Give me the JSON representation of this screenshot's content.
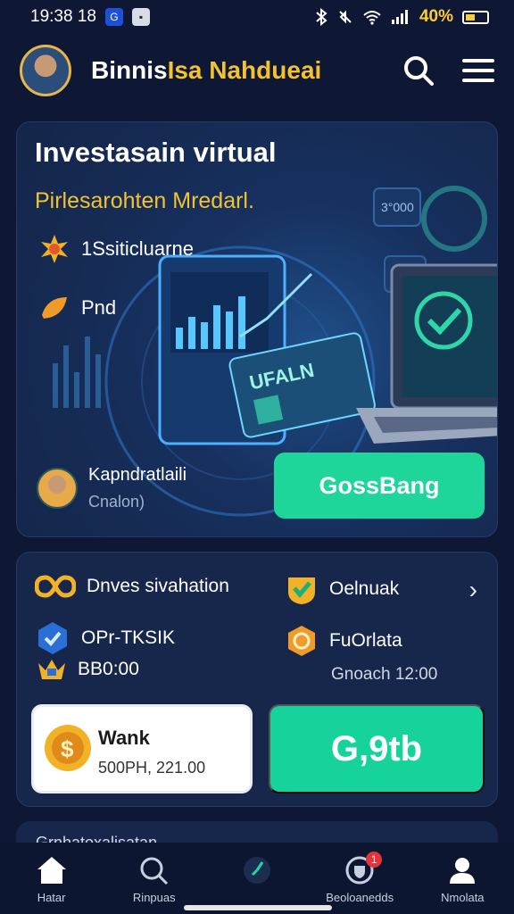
{
  "status_bar": {
    "time": "19:38 18",
    "icon_blue": "G",
    "icon_light": "▪",
    "battery_text": "40%",
    "battery_level": 0.4
  },
  "header": {
    "brand_part1": "Binnis",
    "brand_part2": "Isa Nahdueai"
  },
  "hero": {
    "title": "Investasain virtual",
    "subtitle": "Pirlesarohten Mredarl.",
    "feature_1": "1Ssiticluarne",
    "feature_2": "Pnd",
    "user_name": "Kapndratlaili",
    "user_sub": "Cnalon)",
    "cta_label": "GossBang",
    "illustration_card_text": "UFALN",
    "illustration_tag": "3°000"
  },
  "panel": {
    "row1_left": "Dnves sivahation",
    "row1_right": "Oelnuak",
    "row2_left": "OPr-TKSIK",
    "row2_right": "FuOrlata",
    "row3_left": "BB0:00",
    "row3_right": "Gnoach 12:00",
    "wallet_title": "Wank",
    "wallet_sub": "500PH, 221.00",
    "green_value": "G,9tb"
  },
  "peek": {
    "text": "Grnhatoxalisatan"
  },
  "nav": [
    {
      "label": "Hatar",
      "icon": "home-icon"
    },
    {
      "label": "Rinpuas",
      "icon": "search-icon"
    },
    {
      "label": "",
      "icon": "clock-icon"
    },
    {
      "label": "Beoloanedds",
      "icon": "shield-icon",
      "badge": "1"
    },
    {
      "label": "Nmolata",
      "icon": "profile-icon"
    }
  ],
  "colors": {
    "accent_green": "#1ed69a",
    "accent_gold": "#f2c230",
    "bg": "#0e1733",
    "card": "#17264b"
  }
}
